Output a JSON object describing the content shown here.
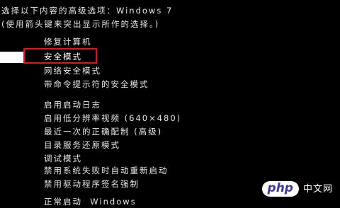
{
  "header": {
    "line1": "选择以下内容的高级选项：Windows 7",
    "line2": "(使用箭头键来突出显示所作的选择。)"
  },
  "menu": {
    "items": [
      {
        "label": "修复计算机"
      },
      {
        "label": "安全模式",
        "selected": true
      },
      {
        "label": "网络安全模式"
      },
      {
        "label": "带命令提示符的安全模式"
      },
      {
        "label": "启用启动日志"
      },
      {
        "label": "启用低分辨率视频 (640×480)"
      },
      {
        "label": "最近一次的正确配制 (高级)"
      },
      {
        "label": "目录服务还原模式"
      },
      {
        "label": "调试模式"
      },
      {
        "label": "禁用系统失败时自动重新启动"
      },
      {
        "label": "禁用驱动程序签名强制"
      },
      {
        "label": "正常启动  Windows"
      }
    ]
  },
  "watermark": {
    "logo_text": "php",
    "site_text": "中文网"
  },
  "colors": {
    "background": "#000000",
    "text": "#e8e8e8",
    "highlight_border": "#e0141c",
    "selection_bar": "#ffffff"
  }
}
